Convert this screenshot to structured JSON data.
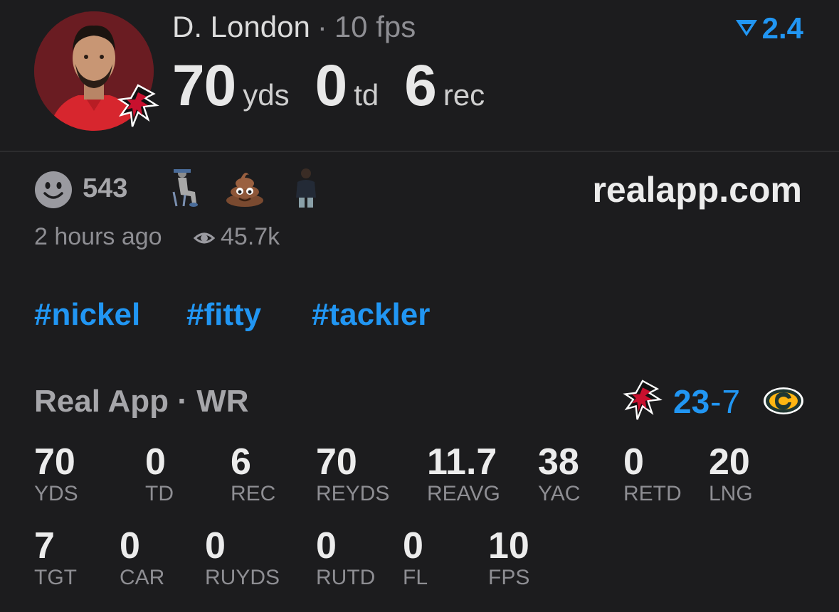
{
  "player": {
    "name": "D. London",
    "sep": "·",
    "fps_label": "10 fps",
    "big_stats": [
      {
        "value": "70",
        "unit": "yds"
      },
      {
        "value": "0",
        "unit": "td"
      },
      {
        "value": "6",
        "unit": "rec"
      }
    ]
  },
  "badge": {
    "value": "2.4",
    "color": "#2196f3"
  },
  "reactions": {
    "count": "543",
    "stickers": [
      "seated-figure-sticker",
      "poop-emoji",
      "standing-figure-sticker"
    ]
  },
  "domain": "realapp.com",
  "meta": {
    "time_ago": "2 hours ago",
    "views": "45.7k"
  },
  "hashtags": [
    "#nickel",
    "#fitty",
    "#tackler"
  ],
  "game": {
    "league": "Real App",
    "sep": "·",
    "position": "WR",
    "score_home": "23",
    "score_dash": "-",
    "score_away": "7"
  },
  "stats_row1": [
    {
      "value": "70",
      "label": "YDS"
    },
    {
      "value": "0",
      "label": "TD"
    },
    {
      "value": "6",
      "label": "REC"
    },
    {
      "value": "70",
      "label": "REYDS"
    },
    {
      "value": "11.7",
      "label": "REAVG"
    },
    {
      "value": "38",
      "label": "YAC"
    },
    {
      "value": "0",
      "label": "RETD"
    },
    {
      "value": "20",
      "label": "LNG"
    }
  ],
  "stats_row2": [
    {
      "value": "7",
      "label": "TGT"
    },
    {
      "value": "0",
      "label": "CAR"
    },
    {
      "value": "0",
      "label": "RUYDS"
    },
    {
      "value": "0",
      "label": "RUTD"
    },
    {
      "value": "0",
      "label": "FL"
    },
    {
      "value": "10",
      "label": "FPS"
    }
  ],
  "colors": {
    "accent": "#2196f3",
    "background": "#1c1c1e",
    "muted": "#8e8e93"
  }
}
